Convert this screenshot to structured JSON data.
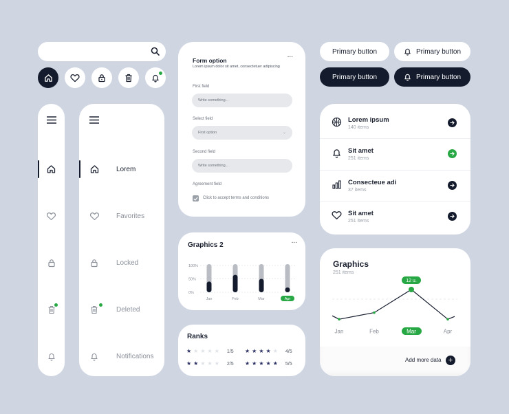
{
  "search": {
    "placeholder": ""
  },
  "icon_buttons": [
    {
      "icon": "home-icon",
      "active": true
    },
    {
      "icon": "heart-icon"
    },
    {
      "icon": "lock-icon"
    },
    {
      "icon": "trash-icon"
    },
    {
      "icon": "bell-icon",
      "badge": true
    }
  ],
  "colors": {
    "dark": "#141b2c",
    "accent": "#27a844",
    "background": "#cfd6e2",
    "star": "#2a2f62"
  },
  "nav": {
    "items": [
      {
        "icon": "home-icon",
        "label": "Lorem",
        "active": true
      },
      {
        "icon": "heart-icon",
        "label": "Favorites"
      },
      {
        "icon": "lock-icon",
        "label": "Locked"
      },
      {
        "icon": "trash-icon",
        "label": "Deleted",
        "badge": true
      },
      {
        "icon": "bell-icon",
        "label": "Notifications"
      }
    ]
  },
  "form": {
    "title": "Form option",
    "subtitle": "Lorem ipsum dolor sit amet, consectetuer adipiscing",
    "first_field": {
      "label": "First field",
      "placeholder": "Write something..."
    },
    "select_field": {
      "label": "Select field",
      "value": "First option"
    },
    "second_field": {
      "label": "Second field",
      "placeholder": "Write something..."
    },
    "agreement": {
      "label": "Agreement field",
      "checkbox_label": "Click to accept terms and conditions",
      "checked": true
    },
    "more": "..."
  },
  "graphics_small": {
    "title": "Graphics  2",
    "more": "...",
    "chart_data": {
      "type": "bar",
      "categories": [
        "Jan",
        "Feb",
        "Mar",
        "Apr"
      ],
      "values": [
        40,
        65,
        50,
        18
      ],
      "yticks": [
        "100%",
        "50%",
        "0%"
      ],
      "ylim": [
        0,
        100
      ],
      "highlight": "Apr"
    }
  },
  "ranks": {
    "title": "Ranks",
    "rows": [
      {
        "stars": 1,
        "label": "1/5"
      },
      {
        "stars": 4,
        "label": "4/5"
      },
      {
        "stars": 2,
        "label": "2/5"
      },
      {
        "stars": 5,
        "label": "5/5"
      }
    ]
  },
  "buttons": {
    "primary": "Primary button",
    "primary_bell": "Primary button",
    "primary_dark": "Primary button",
    "primary_dark_bell": "Primary button"
  },
  "list": [
    {
      "icon": "basketball-icon",
      "title": "Lorem ipsum",
      "sub": "140 items",
      "highlight": false
    },
    {
      "icon": "bell-icon",
      "title": "Sit amet",
      "sub": "251 items",
      "highlight": true
    },
    {
      "icon": "bar-chart-icon",
      "title": "Consecteue adi",
      "sub": "37 items",
      "highlight": false
    },
    {
      "icon": "heart-icon",
      "title": "Sit amet",
      "sub": "251 items",
      "highlight": false
    }
  ],
  "graphics_big": {
    "title": "Graphics",
    "subtitle": "251 items",
    "tooltip": "12 u.",
    "add_label": "Add more data",
    "chart_data": {
      "type": "line",
      "categories": [
        "Jan",
        "Feb",
        "Mar",
        "Apr"
      ],
      "values": [
        3,
        5,
        12,
        3
      ],
      "highlight": "Mar"
    }
  }
}
